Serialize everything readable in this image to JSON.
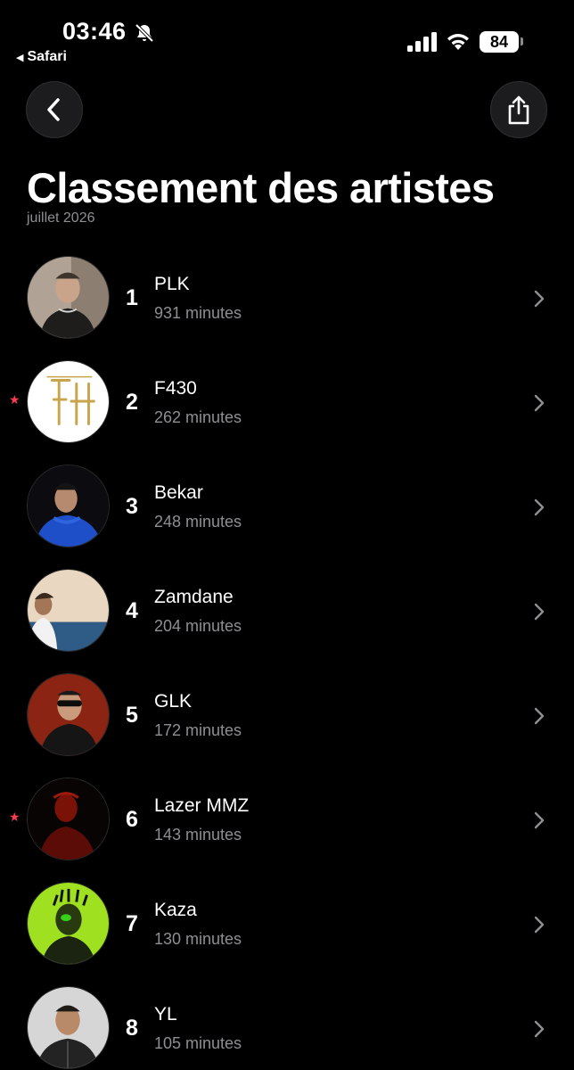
{
  "status_bar": {
    "time": "03:46",
    "back_app": "Safari",
    "battery": "84"
  },
  "header": {
    "title": "Classement des artistes",
    "subtitle": "juillet 2026"
  },
  "artists": [
    {
      "rank": "1",
      "name": "PLK",
      "minutes": "931 minutes",
      "starred": false
    },
    {
      "rank": "2",
      "name": "F430",
      "minutes": "262 minutes",
      "starred": true
    },
    {
      "rank": "3",
      "name": "Bekar",
      "minutes": "248 minutes",
      "starred": false
    },
    {
      "rank": "4",
      "name": "Zamdane",
      "minutes": "204 minutes",
      "starred": false
    },
    {
      "rank": "5",
      "name": "GLK",
      "minutes": "172 minutes",
      "starred": false
    },
    {
      "rank": "6",
      "name": "Lazer MMZ",
      "minutes": "143 minutes",
      "starred": true
    },
    {
      "rank": "7",
      "name": "Kaza",
      "minutes": "130 minutes",
      "starred": false
    },
    {
      "rank": "8",
      "name": "YL",
      "minutes": "105 minutes",
      "starred": false
    }
  ],
  "colors": {
    "background": "#000000",
    "secondary_text": "#8e8e93",
    "star": "#ff3b4f",
    "button_bg": "#1c1c1e"
  },
  "icons": {
    "back": "chevron-left-icon",
    "share": "share-icon",
    "row_chevron": "chevron-right-icon",
    "star": "star-icon"
  }
}
